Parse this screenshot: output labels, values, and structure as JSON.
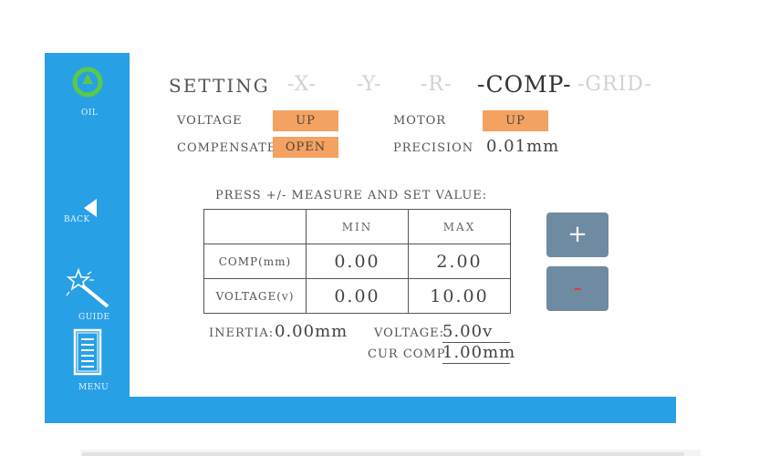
{
  "sidebar": {
    "oil_label": "OIL",
    "back_label": "BACK",
    "guide_label": "GUIDE",
    "menu_label": "MENU",
    "accent": "#28a0e6",
    "oil_icon_color": "#5ac94a"
  },
  "tabs": {
    "title": "SETTING",
    "x": "-X-",
    "y": "-Y-",
    "r": "-R-",
    "comp": "-COMP-",
    "grid": "-GRID-",
    "active": "comp"
  },
  "settings": {
    "voltage_label": "VOLTAGE",
    "voltage_value": "UP",
    "motor_label": "MOTOR",
    "motor_value": "UP",
    "compensate_label": "COMPENSATE",
    "compensate_value": "OPEN",
    "precision_label": "PRECISION",
    "precision_value": "0.01mm",
    "chip_color": "#f4a261"
  },
  "measure": {
    "instruction": "PRESS +/- MEASURE AND SET VALUE:",
    "headers": [
      "",
      "MIN",
      "MAX"
    ],
    "rows": [
      {
        "label": "COMP(mm)",
        "min": "0.00",
        "max": "2.00"
      },
      {
        "label": "VOLTAGE(v)",
        "min": "0.00",
        "max": "10.00"
      }
    ],
    "plus_label": "+",
    "minus_label": "-"
  },
  "status": {
    "inertia_label": "INERTIA:",
    "inertia_value": "0.00mm",
    "voltage_label": "VOLTAGE:",
    "voltage_value": "5.00v",
    "cur_comp_label": "CUR COMP:",
    "cur_comp_value": "1.00mm"
  }
}
